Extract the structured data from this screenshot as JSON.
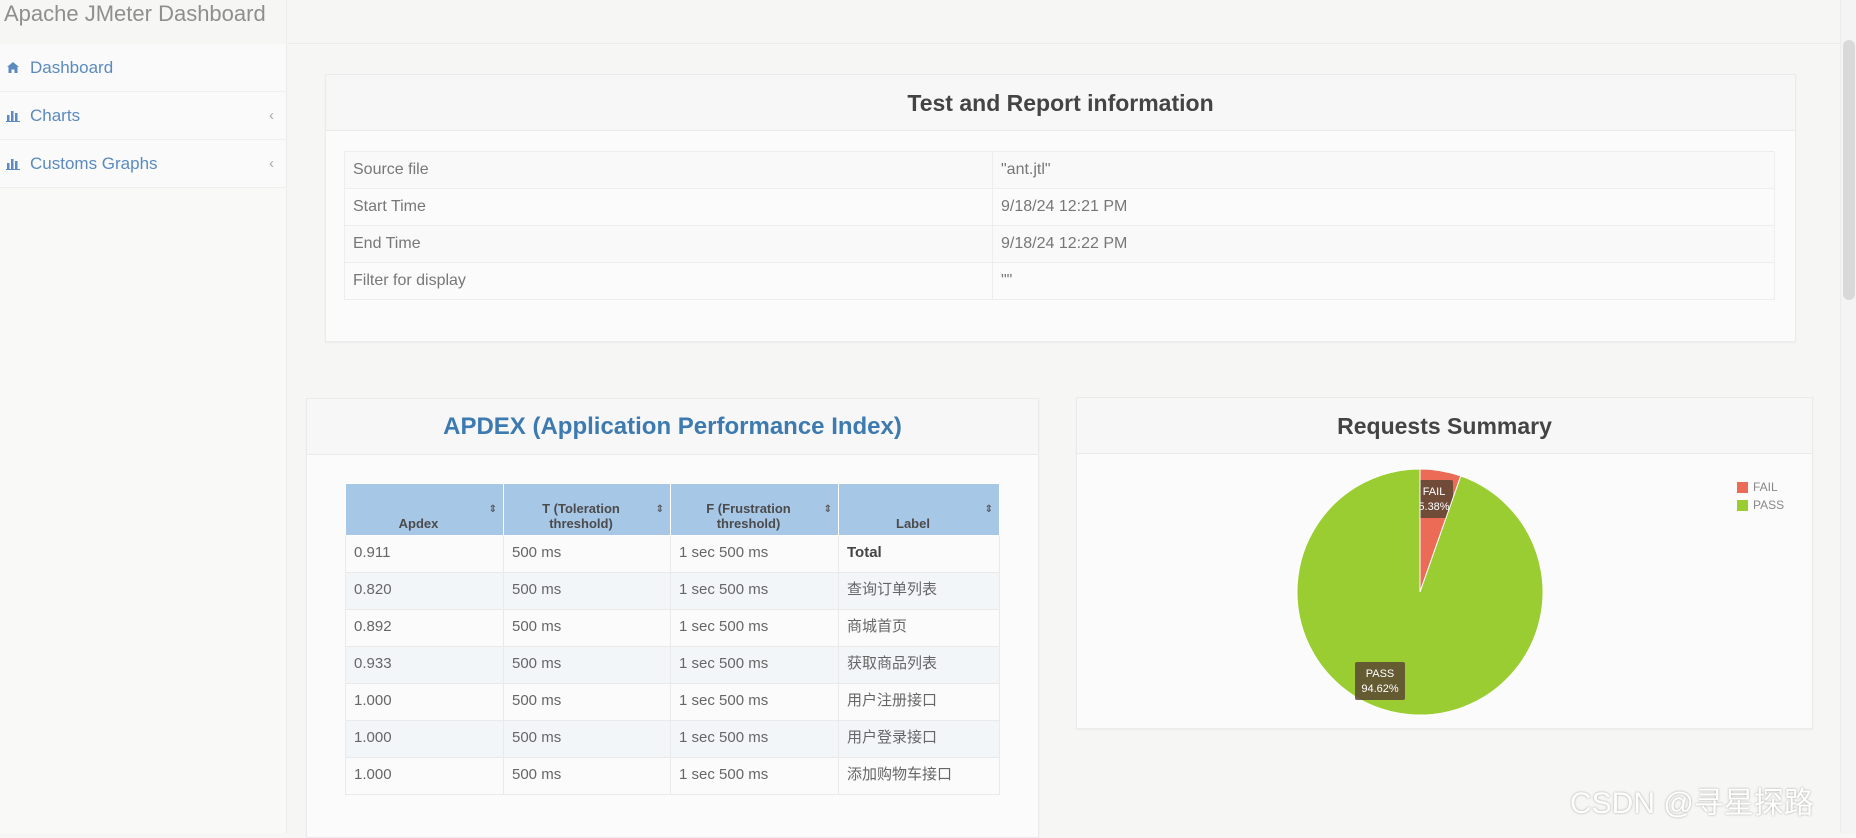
{
  "app": {
    "title": "Apache JMeter Dashboard"
  },
  "sidebar": {
    "items": [
      {
        "label": "Dashboard",
        "icon": "dashboard-icon",
        "has_submenu": false
      },
      {
        "label": "Charts",
        "icon": "bar-chart-icon",
        "has_submenu": true,
        "chevron": "‹"
      },
      {
        "label": "Customs Graphs",
        "icon": "bar-chart-icon",
        "has_submenu": true,
        "chevron": "‹"
      }
    ]
  },
  "report_info": {
    "title": "Test and Report information",
    "rows": [
      {
        "label": "Source file",
        "value": "\"ant.jtl\""
      },
      {
        "label": "Start Time",
        "value": "9/18/24 12:21 PM"
      },
      {
        "label": "End Time",
        "value": "9/18/24 12:22 PM"
      },
      {
        "label": "Filter for display",
        "value": "\"\""
      }
    ]
  },
  "apdex": {
    "title": "APDEX (Application Performance Index)",
    "columns": [
      {
        "label": "Apdex",
        "sort": "⇕"
      },
      {
        "label": "T (Toleration threshold)",
        "sort": "⇕"
      },
      {
        "label": "F (Frustration threshold)",
        "sort": "⇕"
      },
      {
        "label": "Label",
        "sort": "⇕"
      }
    ],
    "rows": [
      {
        "apdex": "0.911",
        "t": "500 ms",
        "f": "1 sec 500 ms",
        "label": "Total"
      },
      {
        "apdex": "0.820",
        "t": "500 ms",
        "f": "1 sec 500 ms",
        "label": "查询订单列表"
      },
      {
        "apdex": "0.892",
        "t": "500 ms",
        "f": "1 sec 500 ms",
        "label": "商城首页"
      },
      {
        "apdex": "0.933",
        "t": "500 ms",
        "f": "1 sec 500 ms",
        "label": "获取商品列表"
      },
      {
        "apdex": "1.000",
        "t": "500 ms",
        "f": "1 sec 500 ms",
        "label": "用户注册接口"
      },
      {
        "apdex": "1.000",
        "t": "500 ms",
        "f": "1 sec 500 ms",
        "label": "用户登录接口"
      },
      {
        "apdex": "1.000",
        "t": "500 ms",
        "f": "1 sec 500 ms",
        "label": "添加购物车接口"
      }
    ]
  },
  "summary": {
    "title": "Requests Summary",
    "legend": [
      {
        "label": "FAIL",
        "color": "#ec6b56"
      },
      {
        "label": "PASS",
        "color": "#9acd32"
      }
    ]
  },
  "chart_data": {
    "type": "pie",
    "title": "Requests Summary",
    "categories": [
      "FAIL",
      "PASS"
    ],
    "values": [
      5.38,
      94.62
    ],
    "labels": [
      "FAIL\n5.38%",
      "PASS\n94.62%"
    ],
    "colors": [
      "#ec6b56",
      "#9acd32"
    ],
    "legend_position": "top-right"
  },
  "watermark": "CSDN @寻星探路"
}
